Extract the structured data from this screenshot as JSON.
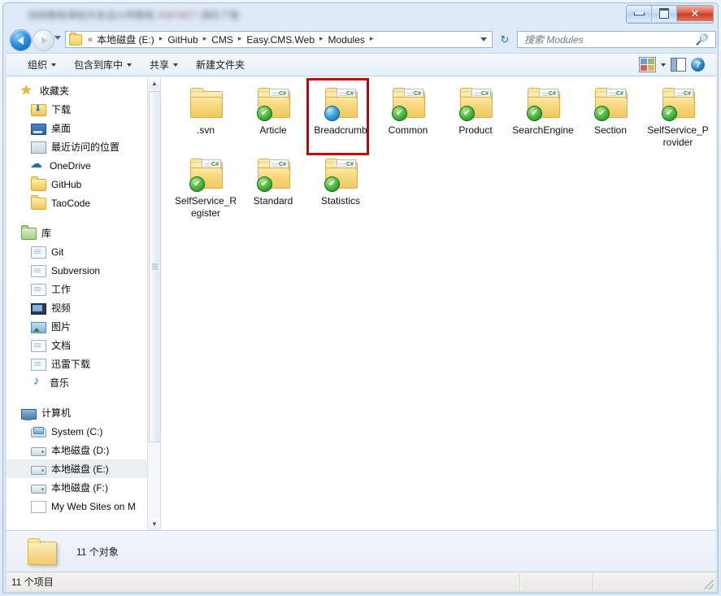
{
  "window": {
    "title_obscured": "■■■■■■■■■■■■■■■■■■■■■■■■■■■■",
    "buttons": {
      "minimize": "minimize",
      "maximize": "maximize",
      "close": "✕"
    }
  },
  "addressbar": {
    "back_tooltip": "后退",
    "forward_tooltip": "前进",
    "overflow_chevron": "«",
    "crumbs": [
      {
        "label": "本地磁盘 (E:)"
      },
      {
        "label": "GitHub"
      },
      {
        "label": "CMS"
      },
      {
        "label": "Easy.CMS.Web"
      },
      {
        "label": "Modules"
      }
    ],
    "separator": "▸",
    "refresh_glyph": "↻"
  },
  "search": {
    "placeholder": "搜索 Modules",
    "icon": "🔎"
  },
  "toolbar": {
    "items": [
      {
        "label": "组织",
        "has_caret": true
      },
      {
        "label": "包含到库中",
        "has_caret": true
      },
      {
        "label": "共享",
        "has_caret": true
      },
      {
        "label": "新建文件夹",
        "has_caret": false
      }
    ],
    "right": {
      "views_icon": "views-icon",
      "views_caret": "▾",
      "preview_pane_icon": "preview-pane-icon",
      "help_icon": "?"
    }
  },
  "sidebar": {
    "groups": [
      {
        "header": {
          "label": "收藏夹",
          "icon": "star-icon"
        },
        "items": [
          {
            "label": "下载",
            "icon": "downloads-icon"
          },
          {
            "label": "桌面",
            "icon": "desktop-icon"
          },
          {
            "label": "最近访问的位置",
            "icon": "recent-places-icon"
          },
          {
            "label": "OneDrive",
            "icon": "onedrive-cloud-icon"
          },
          {
            "label": "GitHub",
            "icon": "folder-icon"
          },
          {
            "label": "TaoCode",
            "icon": "folder-icon"
          }
        ]
      },
      {
        "header": {
          "label": "库",
          "icon": "library-icon"
        },
        "items": [
          {
            "label": "Git",
            "icon": "doclib-icon"
          },
          {
            "label": "Subversion",
            "icon": "doclib-icon"
          },
          {
            "label": "工作",
            "icon": "doclib-icon"
          },
          {
            "label": "视频",
            "icon": "video-library-icon"
          },
          {
            "label": "图片",
            "icon": "picture-library-icon"
          },
          {
            "label": "文档",
            "icon": "document-library-icon"
          },
          {
            "label": "迅雷下载",
            "icon": "doclib-icon"
          },
          {
            "label": "音乐",
            "icon": "music-library-icon"
          }
        ]
      },
      {
        "header": {
          "label": "计算机",
          "icon": "computer-icon"
        },
        "items": [
          {
            "label": "System (C:)",
            "icon": "system-drive-icon",
            "selected": false
          },
          {
            "label": "本地磁盘 (D:)",
            "icon": "drive-icon",
            "selected": false
          },
          {
            "label": "本地磁盘 (E:)",
            "icon": "drive-icon",
            "selected": true
          },
          {
            "label": "本地磁盘 (F:)",
            "icon": "drive-icon",
            "selected": false
          },
          {
            "label": "My Web Sites on M",
            "icon": "network-doc-icon",
            "selected": false
          }
        ]
      }
    ],
    "scrollbar": {
      "up_arrow": "▲",
      "down_arrow": "▼"
    }
  },
  "files": {
    "items": [
      {
        "name": ".svn",
        "overlay": "none",
        "plain": true,
        "annotated": false
      },
      {
        "name": "Article",
        "overlay": "check",
        "plain": false,
        "annotated": false
      },
      {
        "name": "Breadcrumb",
        "overlay": "blue",
        "plain": false,
        "annotated": true
      },
      {
        "name": "Common",
        "overlay": "check",
        "plain": false,
        "annotated": false
      },
      {
        "name": "Product",
        "overlay": "check",
        "plain": false,
        "annotated": false
      },
      {
        "name": "SearchEngine",
        "overlay": "check",
        "plain": false,
        "annotated": false
      },
      {
        "name": "Section",
        "overlay": "check",
        "plain": false,
        "annotated": false
      },
      {
        "name": "SelfService_Provider",
        "overlay": "check",
        "plain": false,
        "annotated": false
      },
      {
        "name": "SelfService_Register",
        "overlay": "check",
        "plain": false,
        "annotated": false
      },
      {
        "name": "Standard",
        "overlay": "check",
        "plain": false,
        "annotated": false
      },
      {
        "name": "Statistics",
        "overlay": "check",
        "plain": false,
        "annotated": false
      }
    ],
    "check_glyph": "✔",
    "cs_badge": "C#"
  },
  "details_pane": {
    "object_count": "11 个对象"
  },
  "statusbar": {
    "item_count": "11 个项目"
  },
  "colors": {
    "annotation_red": "#cc0000",
    "svn_green": "#46b33c",
    "folder_yellow": "#f2cd6d",
    "selection_gray": "#eceff2"
  }
}
